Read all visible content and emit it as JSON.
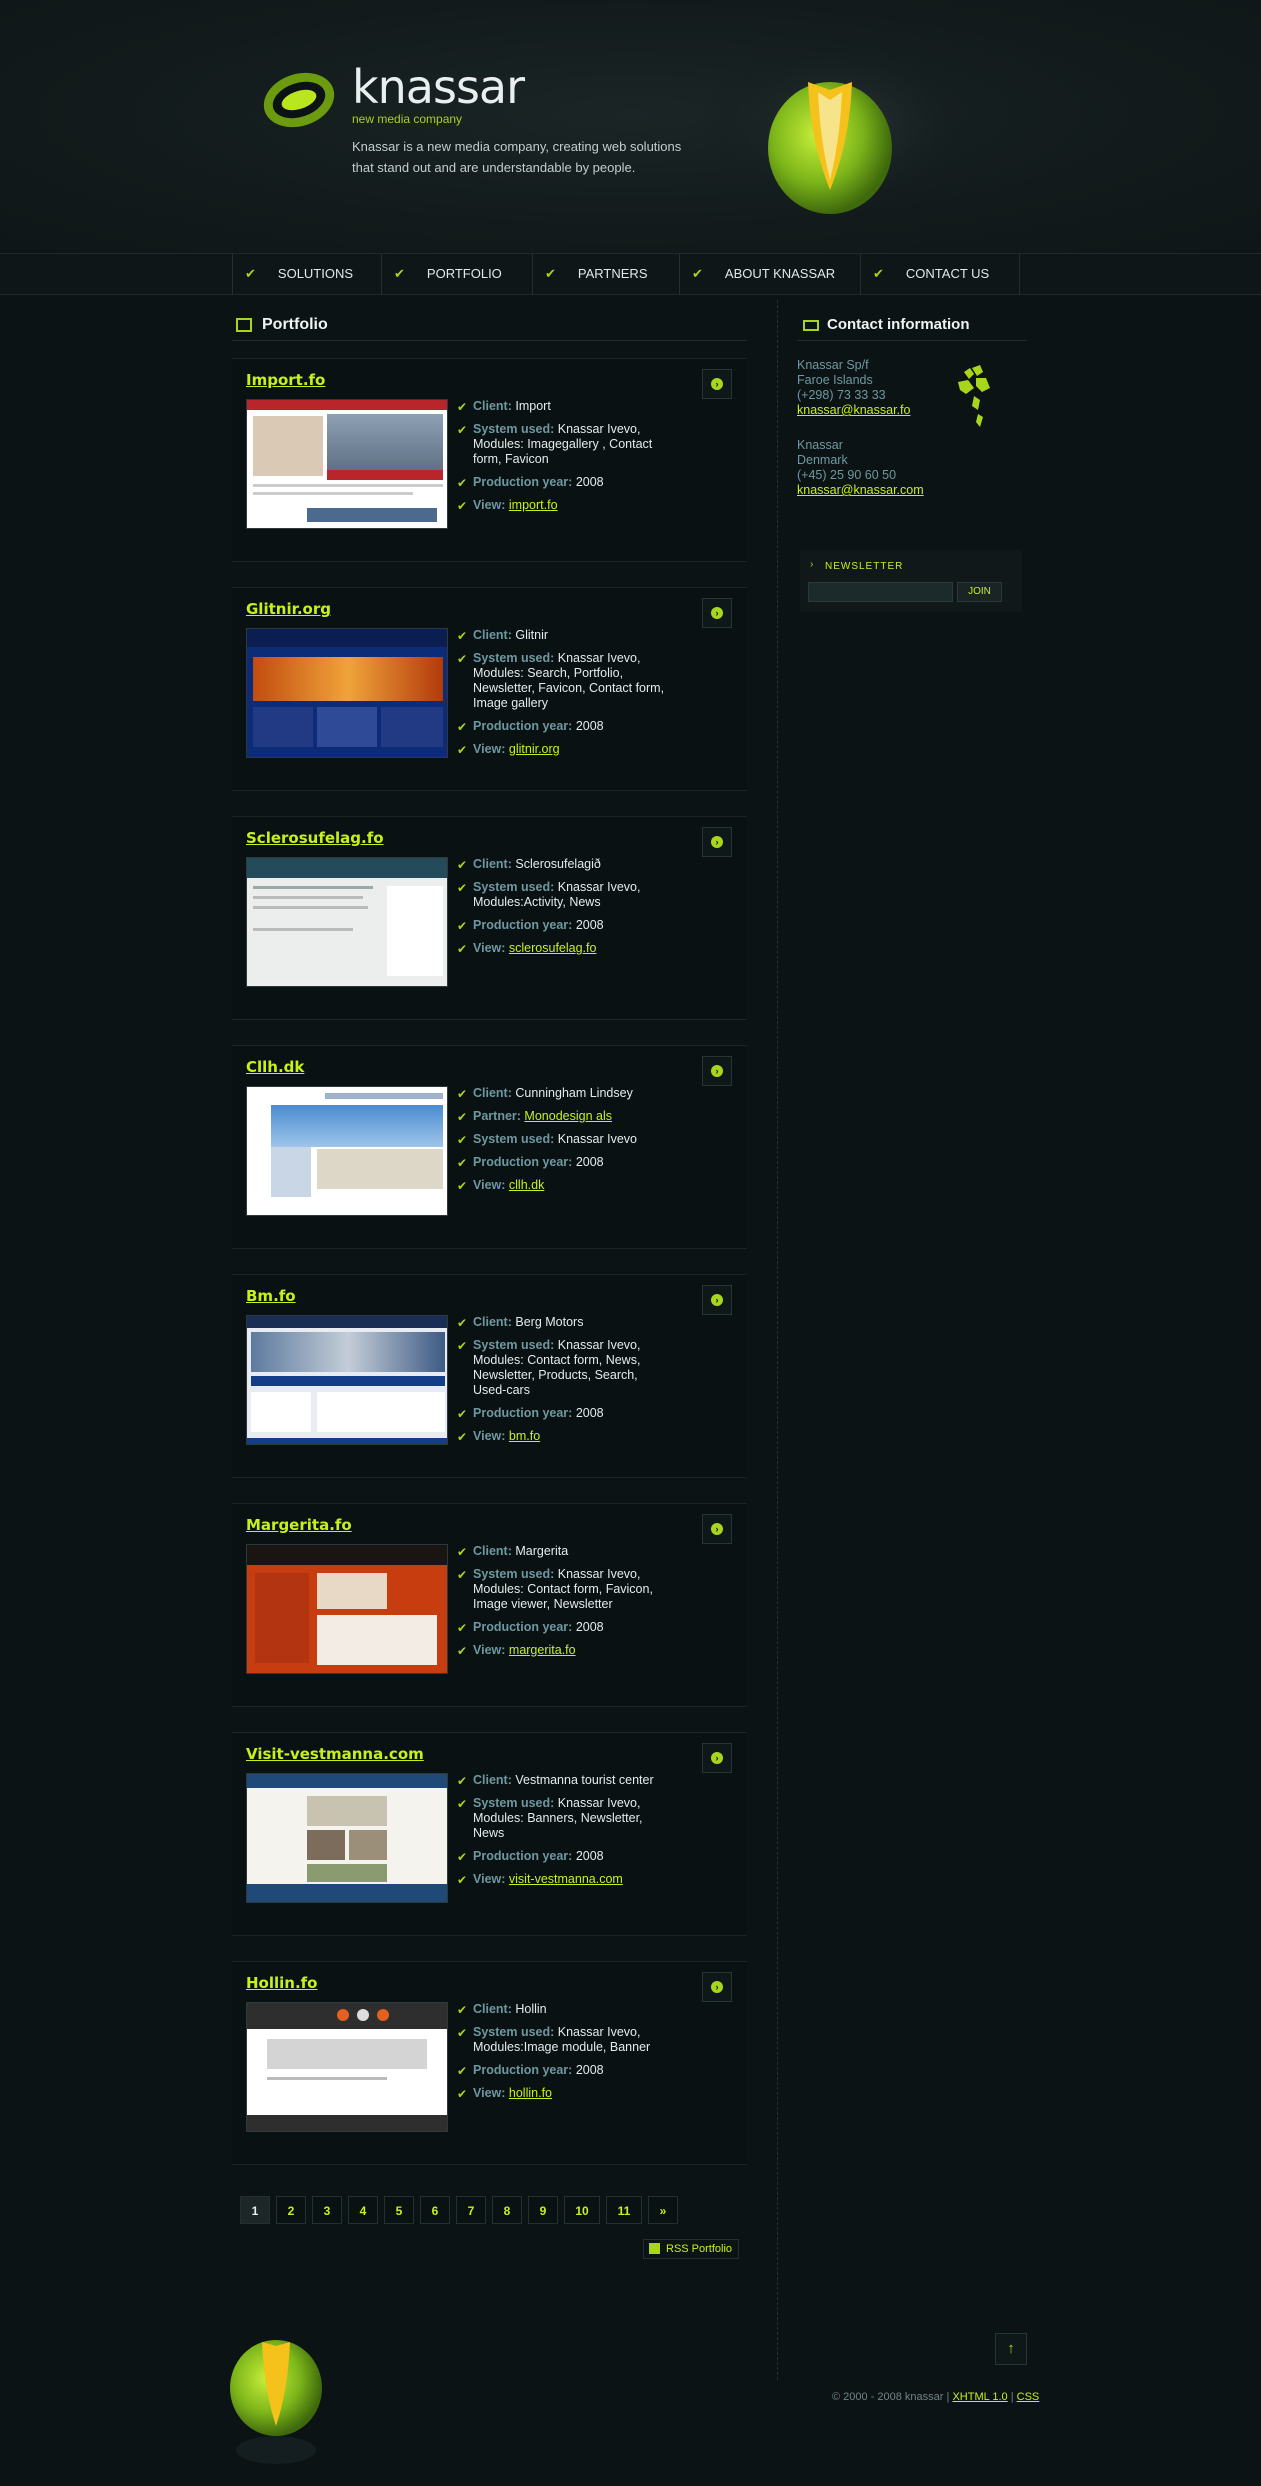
{
  "header": {
    "logo_text": "knassar",
    "tagline": "new media company",
    "intro": "Knassar is a new media company, creating web solutions that stand out and are understandable by people."
  },
  "nav": [
    {
      "label": "SOLUTIONS"
    },
    {
      "label": "PORTFOLIO"
    },
    {
      "label": "PARTNERS"
    },
    {
      "label": "ABOUT KNASSAR"
    },
    {
      "label": "CONTACT US"
    }
  ],
  "portfolio": {
    "heading": "Portfolio",
    "labels": {
      "client": "Client:",
      "partner": "Partner:",
      "system": "System used:",
      "year": "Production year:",
      "view": "View:"
    },
    "items": [
      {
        "title": "Import.fo",
        "client": "Import",
        "system": "Knassar Ivevo, Modules: Imagegallery , Contact form, Favicon",
        "year": "2008",
        "view": "import.fo",
        "thumb_colors": [
          "#ffffff",
          "#b8252a",
          "#5b6e80"
        ]
      },
      {
        "title": "Glitnir.org",
        "client": "Glitnir",
        "system": "Knassar Ivevo, Modules: Search, Portfolio, Newsletter, Favicon, Contact form, Image gallery",
        "year": "2008",
        "view": "glitnir.org",
        "thumb_colors": [
          "#0d2c78",
          "#e4731b",
          "#223a84"
        ]
      },
      {
        "title": "Sclerosufelag.fo",
        "client": "Sclerosufelagið",
        "system": "Knassar Ivevo, Modules:Activity, News",
        "year": "2008",
        "view": "sclerosufelag.fo",
        "thumb_colors": [
          "#eceeee",
          "#244b5a",
          "#ffffff"
        ]
      },
      {
        "title": "Cllh.dk",
        "client": "Cunningham Lindsey",
        "partner": "Monodesign als",
        "system": "Knassar Ivevo",
        "year": "2008",
        "view": "cllh.dk",
        "thumb_colors": [
          "#ffffff",
          "#3d74b8",
          "#dcd7c6"
        ]
      },
      {
        "title": "Bm.fo",
        "client": "Berg Motors",
        "system": "Knassar Ivevo, Modules: Contact form, News, Newsletter, Products, Search, Used-cars",
        "year": "2008",
        "view": "bm.fo",
        "thumb_colors": [
          "#e8ecf2",
          "#153e8a",
          "#1a2d55"
        ]
      },
      {
        "title": "Margerita.fo",
        "client": "Margerita",
        "system": "Knassar Ivevo, Modules: Contact form, Favicon, Image viewer, Newsletter",
        "year": "2008",
        "view": "margerita.fo",
        "thumb_colors": [
          "#1a1512",
          "#c83d10",
          "#f3ece4"
        ]
      },
      {
        "title": "Visit-vestmanna.com",
        "client": "Vestmanna tourist center",
        "system": "Knassar Ivevo, Modules: Banners, Newsletter, News",
        "year": "2008",
        "view": "visit-vestmanna.com",
        "thumb_colors": [
          "#f4f3ee",
          "#1f4a77",
          "#6f8a3a"
        ]
      },
      {
        "title": "Hollin.fo",
        "client": "Hollin",
        "system": "Knassar Ivevo, Modules:Image module, Banner",
        "year": "2008",
        "view": "hollin.fo",
        "thumb_colors": [
          "#2e2e2e",
          "#ffffff",
          "#e55f1e"
        ]
      }
    ]
  },
  "pagination": {
    "pages": [
      "1",
      "2",
      "3",
      "4",
      "5",
      "6",
      "7",
      "8",
      "9",
      "10",
      "11",
      "»"
    ],
    "current": "1"
  },
  "rss": {
    "label": "RSS Portfolio"
  },
  "contact": {
    "heading": "Contact information",
    "office1": [
      "Knassar Sp/f",
      "Faroe Islands",
      "(+298) 73 33 33"
    ],
    "email1": "knassar@knassar.fo",
    "office2": [
      "Knassar",
      "Denmark",
      "(+45) 25 90 60 50"
    ],
    "email2": "knassar@knassar.com"
  },
  "newsletter": {
    "label": "NEWSLETTER",
    "input_value": "",
    "join_label": "JOIN"
  },
  "footer": {
    "copyright": "© 2000 - 2008 knassar",
    "xhtml": "XHTML 1.0",
    "css": "CSS",
    "sep": "|"
  },
  "colors": {
    "background": "#0c1314",
    "accent": "#c6f21a",
    "label": "#6e98a0",
    "text": "#e6ecec"
  }
}
